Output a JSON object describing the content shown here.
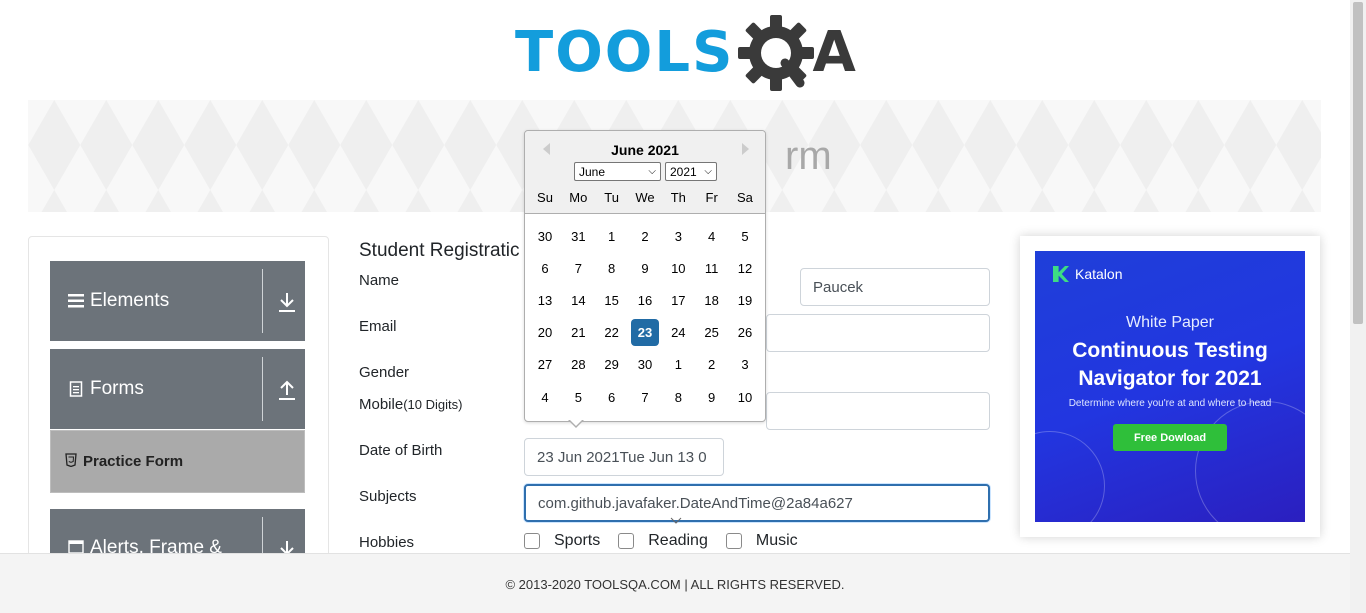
{
  "header": {
    "logo_tools": "TOOLS",
    "logo_q_alt": "Q",
    "logo_a": "A"
  },
  "banner": {
    "title_partial": "rm"
  },
  "sidebar": {
    "groups": [
      {
        "label": "Elements",
        "icon": "hamburger-icon",
        "arrow": "download-arrow-icon"
      },
      {
        "label": "Forms",
        "icon": "document-icon",
        "arrow": "upload-arrow-icon"
      },
      {
        "label": "Alerts, Frame &",
        "icon": "window-icon",
        "arrow": "download-arrow-icon"
      }
    ],
    "active_item": {
      "label": "Practice Form",
      "icon": "html5-icon"
    }
  },
  "form": {
    "title": "Student Registratic",
    "labels": {
      "name": "Name",
      "email": "Email",
      "gender": "Gender",
      "mobile": "Mobile",
      "mobile_hint": "(10 Digits)",
      "dob": "Date of Birth",
      "subjects": "Subjects",
      "hobbies": "Hobbies"
    },
    "last_name_value": "Paucek",
    "dob_value": "23 Jun 2021Tue Jun 13 0",
    "subjects_value": "com.github.javafaker.DateAndTime@2a84a627",
    "hobbies": [
      "Sports",
      "Reading",
      "Music"
    ]
  },
  "datepicker": {
    "month_title": "June 2021",
    "month_select": "June",
    "year_select": "2021",
    "weekdays": [
      "Su",
      "Mo",
      "Tu",
      "We",
      "Th",
      "Fr",
      "Sa"
    ],
    "weeks": [
      [
        "30",
        "31",
        "1",
        "2",
        "3",
        "4",
        "5"
      ],
      [
        "6",
        "7",
        "8",
        "9",
        "10",
        "11",
        "12"
      ],
      [
        "13",
        "14",
        "15",
        "16",
        "17",
        "18",
        "19"
      ],
      [
        "20",
        "21",
        "22",
        "23",
        "24",
        "25",
        "26"
      ],
      [
        "27",
        "28",
        "29",
        "30",
        "1",
        "2",
        "3"
      ],
      [
        "4",
        "5",
        "6",
        "7",
        "8",
        "9",
        "10"
      ]
    ],
    "selected_day": "23",
    "selected_color": "#216ba5"
  },
  "ad": {
    "brand": "Katalon",
    "subtitle": "White Paper",
    "title_line1": "Continuous Testing",
    "title_line2": "Navigator for 2021",
    "description": "Determine where you're at and where to head",
    "button": "Free Dowload",
    "button_color": "#2fbf3a"
  },
  "footer": {
    "text": "© 2013-2020 TOOLSQA.COM | ALL RIGHTS RESERVED."
  },
  "colors": {
    "brand_blue": "#139ddc",
    "sidebar_header": "#6c737a",
    "active_item": "#aaaaaa"
  }
}
